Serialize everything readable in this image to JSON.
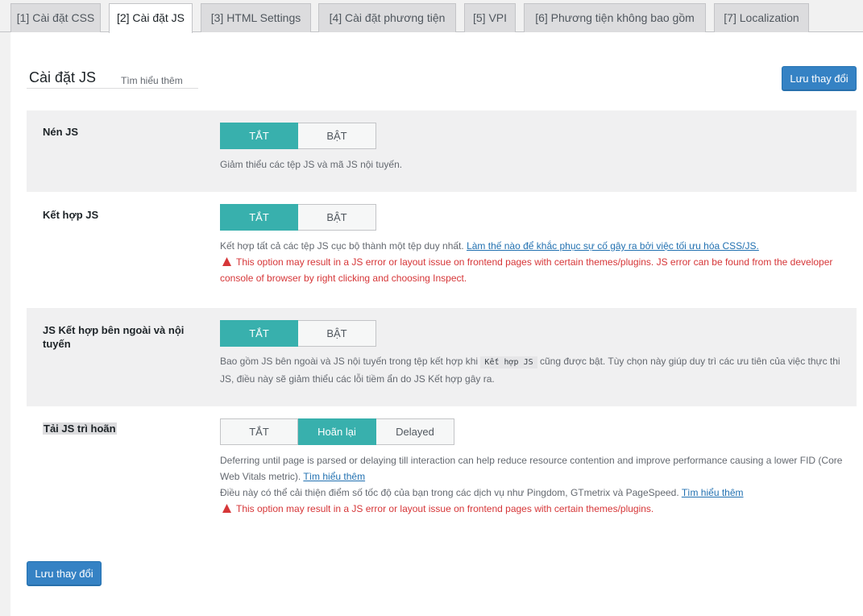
{
  "tabs": [
    {
      "label": "[1] Cài đặt CSS",
      "active": false
    },
    {
      "label": "[2] Cài đặt JS",
      "active": true
    },
    {
      "label": "[3] HTML Settings",
      "active": false
    },
    {
      "label": "[4] Cài đặt phương tiện",
      "active": false
    },
    {
      "label": "[5] VPI",
      "active": false
    },
    {
      "label": "[6] Phương tiện không bao gồm",
      "active": false
    },
    {
      "label": "[7] Localization",
      "active": false
    }
  ],
  "header": {
    "title": "Cài đặt JS",
    "learn_more": "Tìm hiểu thêm",
    "save_button": "Lưu thay đổi"
  },
  "settings": {
    "minify": {
      "label": "Nén JS",
      "options": [
        "TẮT",
        "BẬT"
      ],
      "selected": "TẮT",
      "description": "Giảm thiểu các tệp JS và mã JS nội tuyến."
    },
    "combine": {
      "label": "Kết hợp JS",
      "options": [
        "TẮT",
        "BẬT"
      ],
      "selected": "TẮT",
      "description": "Kết hợp tất cả các tệp JS cục bộ thành một tệp duy nhất.",
      "link": "Làm thế nào để khắc phục sự cố gây ra bởi việc tối ưu hóa CSS/JS.",
      "warning": "This option may result in a JS error or layout issue on frontend pages with certain themes/plugins. JS error can be found from the developer console of browser by right clicking and choosing Inspect."
    },
    "combine_ext": {
      "label": "JS Kết hợp bên ngoài và nội tuyến",
      "options": [
        "TẮT",
        "BẬT"
      ],
      "selected": "TẮT",
      "desc_before": "Bao gồm JS bên ngoài và JS nội tuyến trong tệp kết hợp khi",
      "desc_code": "Kết hợp JS",
      "desc_after": "cũng được bật. Tùy chọn này giúp duy trì các ưu tiên của việc thực thi JS, điều này sẽ giảm thiểu các lỗi tiềm ẩn do JS Kết hợp gây ra."
    },
    "deferred": {
      "label": "Tải JS trì hoãn",
      "options": [
        "TẮT",
        "Hoãn lại",
        "Delayed"
      ],
      "selected": "Hoãn lại",
      "desc1": "Deferring until page is parsed or delaying till interaction can help reduce resource contention and improve performance causing a lower FID (Core Web Vitals metric).",
      "desc1_link": "Tìm hiểu thêm",
      "desc2": "Điều này có thể cải thiện điểm số tốc độ của bạn trong các dịch vụ như Pingdom, GTmetrix và PageSpeed.",
      "desc2_link": "Tìm hiểu thêm",
      "warning": "This option may result in a JS error or layout issue on frontend pages with certain themes/plugins."
    }
  },
  "footer": {
    "save_button": "Lưu thay đổi"
  },
  "colors": {
    "toggle_on": "#38b0ad",
    "primary": "#3582c4",
    "warning": "#d63638",
    "link": "#2271b1"
  }
}
